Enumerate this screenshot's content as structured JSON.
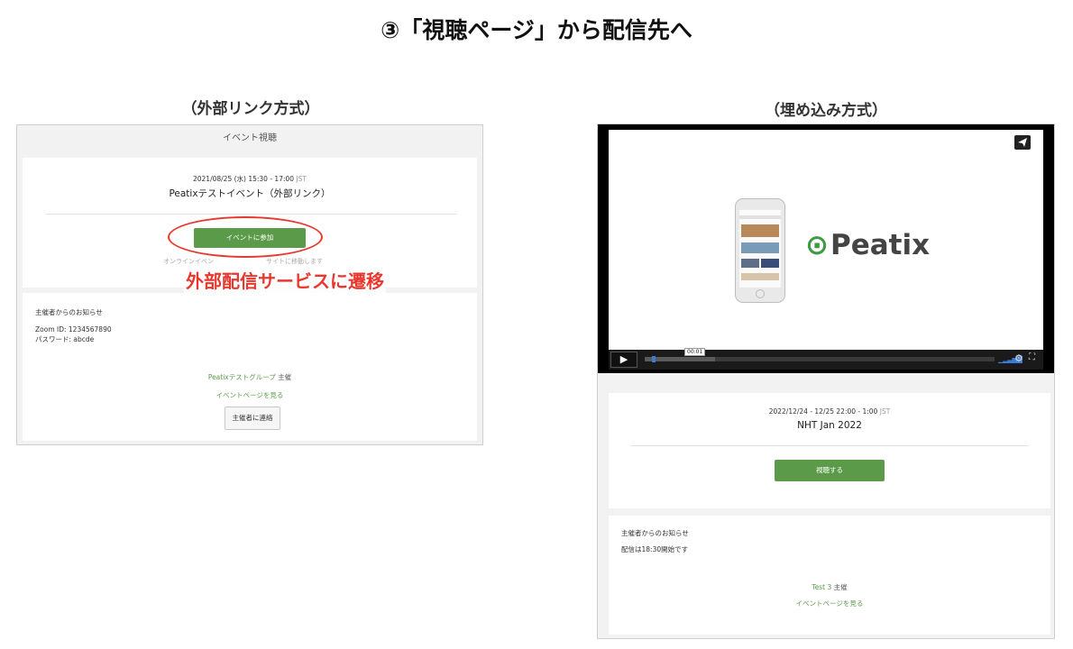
{
  "slide": {
    "title": "③「視聴ページ」から配信先へ",
    "left_caption": "（外部リンク方式）",
    "right_caption": "（埋め込み方式）",
    "annotation": "外部配信サービスに遷移",
    "accent_red": "#e8382e",
    "brand_green": "#5b9a48"
  },
  "left": {
    "header": "イベント視聴",
    "date": "2021/08/25 (水) 15:30 - 17:00",
    "tz": "JST",
    "event_title": "Peatixテストイベント（外部リンク）",
    "join_button": "イベントに参加",
    "note_left": "オンラインイベン",
    "note_right": "サイトに移動します",
    "notice_heading": "主催者からのお知らせ",
    "notice_lines": [
      "Zoom ID: 1234567890",
      "パスワード: abcde"
    ],
    "host_name": "Peatixテストグループ",
    "host_suffix": "主催",
    "event_page_link": "イベントページを見る",
    "contact_button": "主催者に連絡"
  },
  "right": {
    "video": {
      "brand": "Peatix",
      "time": "00:01",
      "progress": 0.02,
      "buffered": 0.2,
      "share_icon": "paper-plane-icon",
      "play_icon": "play-icon"
    },
    "date": "2022/12/24 - 12/25 22:00 - 1:00",
    "tz": "JST",
    "event_title": "NHT Jan 2022",
    "watch_button": "視聴する",
    "notice_heading": "主催者からのお知らせ",
    "notice_line": "配信は18:30開始です",
    "host_name": "Test 3",
    "host_suffix": "主催",
    "event_page_link": "イベントページを見る"
  }
}
